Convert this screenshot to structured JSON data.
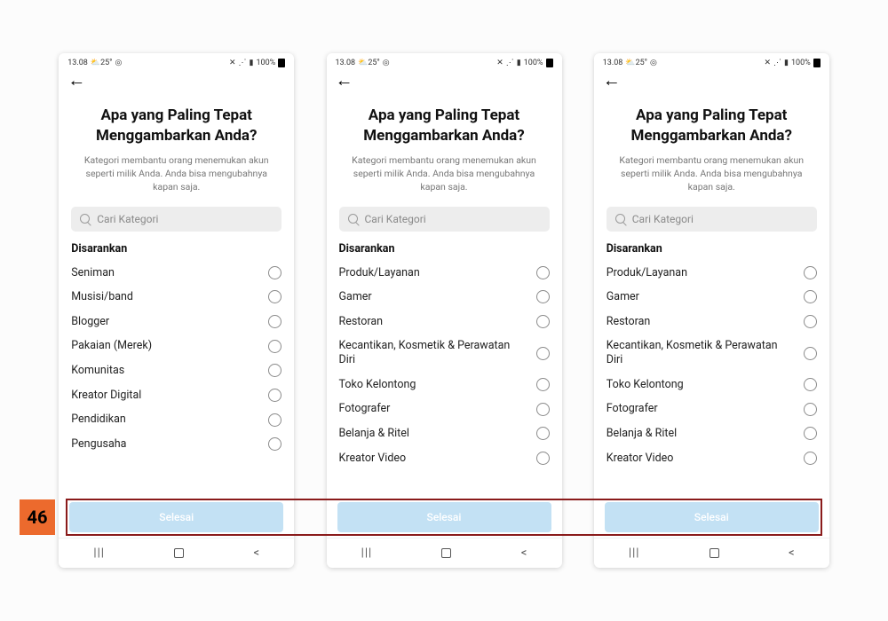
{
  "callout_number": "46",
  "statusbar": {
    "time": "13.08",
    "temp_icon": "25°",
    "extra_icon": "◎",
    "mute_icon": "✕",
    "wifi_icon": "⋰",
    "signal_icon": "▮",
    "battery_pct": "100%"
  },
  "header": {
    "title": "Apa yang Paling Tepat Menggambarkan Anda?",
    "subtitle": "Kategori membantu orang menemukan akun seperti milik Anda. Anda bisa mengubahnya kapan saja."
  },
  "search": {
    "placeholder": "Cari Kategori"
  },
  "section_label": "Disarankan",
  "done_label": "Selesai",
  "nav": {
    "recent": "|||",
    "back": "<"
  },
  "screens": [
    {
      "options": [
        "Seniman",
        "Musisi/band",
        "Blogger",
        "Pakaian (Merek)",
        "Komunitas",
        "Kreator Digital",
        "Pendidikan",
        "Pengusaha"
      ]
    },
    {
      "options": [
        "Produk/Layanan",
        "Gamer",
        "Restoran",
        "Kecantikan, Kosmetik & Perawatan Diri",
        "Toko Kelontong",
        "Fotografer",
        "Belanja & Ritel",
        "Kreator Video"
      ]
    },
    {
      "options": [
        "Produk/Layanan",
        "Gamer",
        "Restoran",
        "Kecantikan, Kosmetik & Perawatan Diri",
        "Toko Kelontong",
        "Fotografer",
        "Belanja & Ritel",
        "Kreator Video"
      ]
    }
  ]
}
